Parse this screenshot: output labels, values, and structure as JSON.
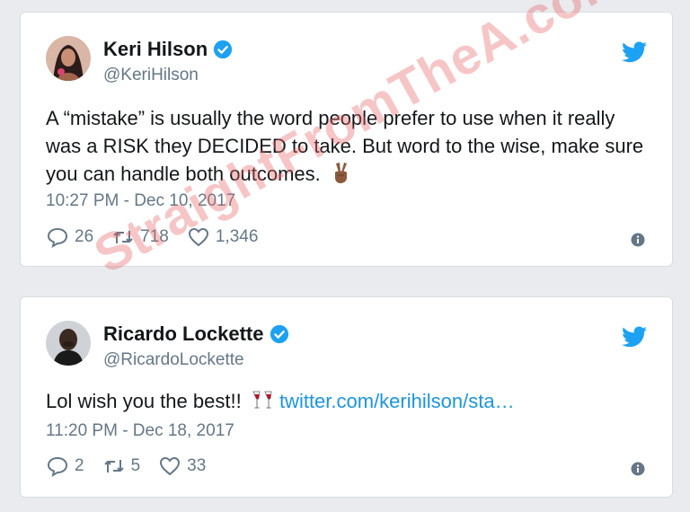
{
  "tweets": [
    {
      "name": "Keri Hilson",
      "handle": "@KeriHilson",
      "text": "A “mistake” is usually the word people prefer to use when it really was a RISK they DECIDED to take. But word to the wise, make sure you can handle both outcomes.",
      "emoji": "victory-hand-emoji",
      "timestamp": "10:27 PM - Dec 10, 2017",
      "replies": "26",
      "retweets": "718",
      "likes": "1,346"
    },
    {
      "name": "Ricardo Lockette",
      "handle": "@RicardoLockette",
      "text": "Lol wish you the best!!",
      "emoji": "clinking-glasses-emoji",
      "link": "twitter.com/kerihilson/sta…",
      "timestamp": "11:20 PM - Dec 18, 2017",
      "replies": "2",
      "retweets": "5",
      "likes": "33"
    }
  ],
  "watermark": "StraightFromTheA.com",
  "colors": {
    "twitter_blue": "#1da1f2",
    "link": "#1b95e0",
    "secondary_text": "#657786",
    "watermark": "#e7686c"
  }
}
